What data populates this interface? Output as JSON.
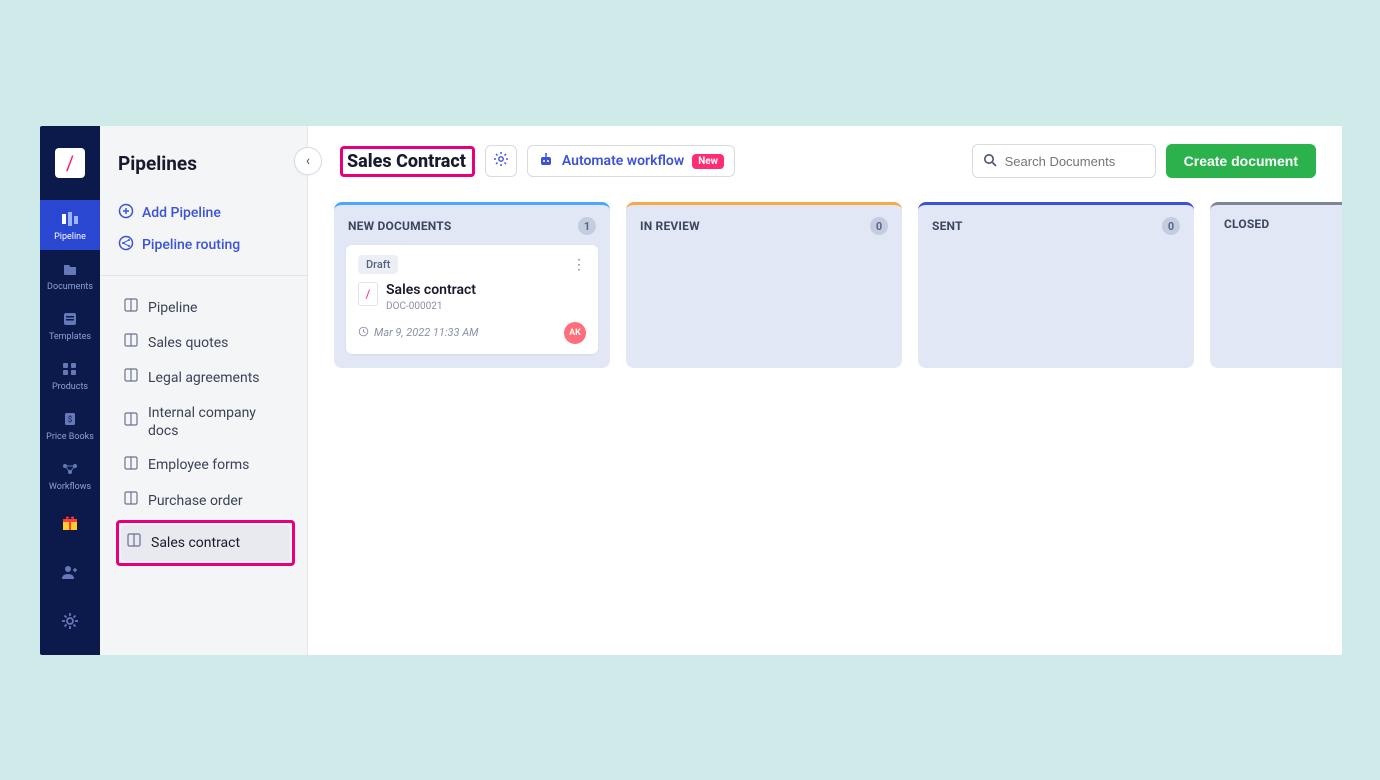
{
  "rail": {
    "items": [
      {
        "label": "Pipeline"
      },
      {
        "label": "Documents"
      },
      {
        "label": "Templates"
      },
      {
        "label": "Products"
      },
      {
        "label": "Price Books"
      },
      {
        "label": "Workflows"
      }
    ]
  },
  "sidebar": {
    "title": "Pipelines",
    "add_label": "Add Pipeline",
    "routing_label": "Pipeline routing",
    "nav": [
      {
        "label": "Pipeline"
      },
      {
        "label": "Sales quotes"
      },
      {
        "label": "Legal agreements"
      },
      {
        "label": "Internal company docs"
      },
      {
        "label": "Employee forms"
      },
      {
        "label": "Purchase order"
      },
      {
        "label": "Sales contract"
      }
    ]
  },
  "header": {
    "title": "Sales Contract",
    "automate_label": "Automate workflow",
    "new_badge": "New",
    "search_placeholder": "Search Documents",
    "create_label": "Create document"
  },
  "board": {
    "columns": [
      {
        "title": "NEW DOCUMENTS",
        "count": "1",
        "accent": "#4aa8ff"
      },
      {
        "title": "IN REVIEW",
        "count": "0",
        "accent": "#f7a94a"
      },
      {
        "title": "SENT",
        "count": "0",
        "accent": "#3d53d6"
      },
      {
        "title": "CLOSED",
        "count": "",
        "accent": "#7d8596"
      }
    ],
    "card": {
      "badge": "Draft",
      "title": "Sales contract",
      "doc_id": "DOC-000021",
      "timestamp": "Mar 9, 2022 11:33 AM",
      "avatar": "AK"
    }
  }
}
